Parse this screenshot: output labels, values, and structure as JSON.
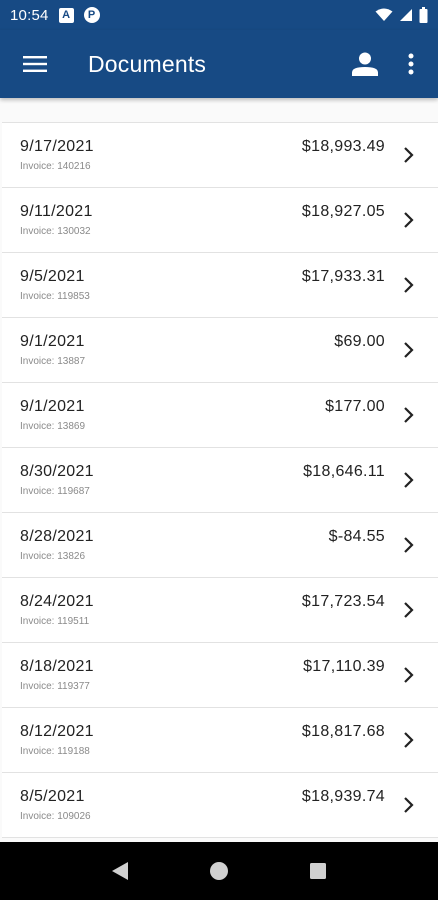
{
  "status_bar": {
    "time": "10:54",
    "notif_a": "A",
    "notif_p": "P"
  },
  "app_bar": {
    "title": "Documents",
    "menu_icon": "hamburger-menu-icon",
    "profile_icon": "person-icon",
    "more_icon": "more-vert-icon"
  },
  "documents": [
    {
      "date": "9/17/2021",
      "invoice": "Invoice: 140216",
      "amount": "$18,993.49"
    },
    {
      "date": "9/11/2021",
      "invoice": "Invoice: 130032",
      "amount": "$18,927.05"
    },
    {
      "date": "9/5/2021",
      "invoice": "Invoice: 119853",
      "amount": "$17,933.31"
    },
    {
      "date": "9/1/2021",
      "invoice": "Invoice: 13887",
      "amount": "$69.00"
    },
    {
      "date": "9/1/2021",
      "invoice": "Invoice: 13869",
      "amount": "$177.00"
    },
    {
      "date": "8/30/2021",
      "invoice": "Invoice: 119687",
      "amount": "$18,646.11"
    },
    {
      "date": "8/28/2021",
      "invoice": "Invoice: 13826",
      "amount": "$-84.55"
    },
    {
      "date": "8/24/2021",
      "invoice": "Invoice: 119511",
      "amount": "$17,723.54"
    },
    {
      "date": "8/18/2021",
      "invoice": "Invoice: 119377",
      "amount": "$17,110.39"
    },
    {
      "date": "8/12/2021",
      "invoice": "Invoice: 119188",
      "amount": "$18,817.68"
    },
    {
      "date": "8/5/2021",
      "invoice": "Invoice: 109026",
      "amount": "$18,939.74"
    }
  ],
  "nav_bar": {
    "back_icon": "back-triangle-icon",
    "home_icon": "home-circle-icon",
    "recents_icon": "recents-square-icon"
  },
  "colors": {
    "primary": "#174a84",
    "divider": "#e2e2e2",
    "secondary_text": "#8a8a8a"
  }
}
